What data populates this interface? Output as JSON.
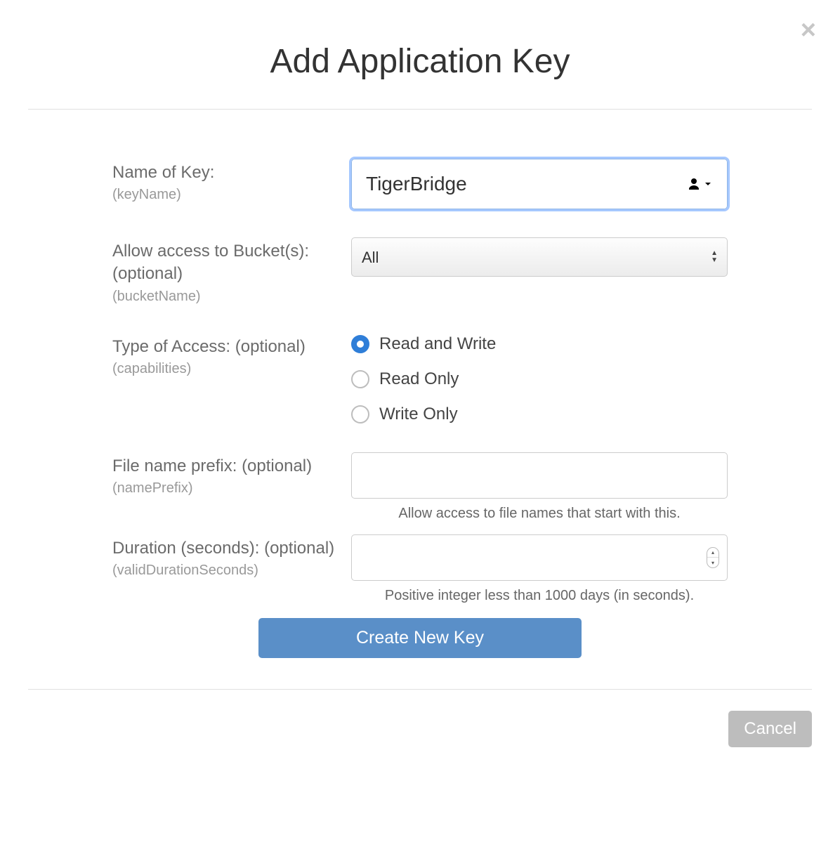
{
  "title": "Add Application Key",
  "close_label": "×",
  "fields": {
    "keyName": {
      "label": "Name of Key:",
      "api": "(keyName)",
      "value": "TigerBridge"
    },
    "bucket": {
      "label": "Allow access to Bucket(s): (optional)",
      "api": "(bucketName)",
      "selected": "All"
    },
    "access": {
      "label": "Type of Access: (optional)",
      "api": "(capabilities)",
      "options": {
        "rw": "Read and Write",
        "r": "Read Only",
        "w": "Write Only"
      },
      "selected": "rw"
    },
    "prefix": {
      "label": "File name prefix: (optional)",
      "api": "(namePrefix)",
      "value": "",
      "hint": "Allow access to file names that start with this."
    },
    "duration": {
      "label": "Duration (seconds): (optional)",
      "api": "(validDurationSeconds)",
      "value": "",
      "hint": "Positive integer less than 1000 days (in seconds)."
    }
  },
  "buttons": {
    "submit": "Create New Key",
    "cancel": "Cancel"
  }
}
